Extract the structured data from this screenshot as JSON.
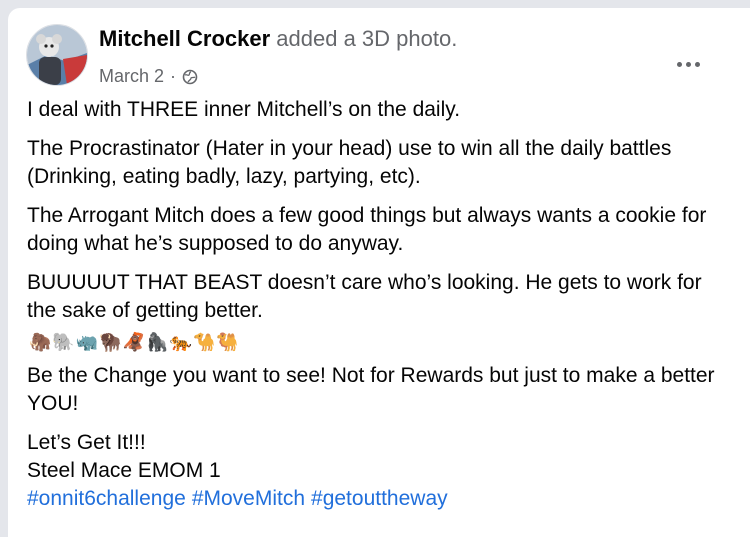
{
  "post": {
    "author": "Mitchell Crocker",
    "action": "added a 3D photo.",
    "date": "March 2",
    "separator": "·",
    "privacy_icon": "globe-icon",
    "menu_icon": "more-options-icon",
    "paragraphs": [
      "I deal with THREE inner Mitchell’s on the daily.",
      "The Procrastinator (Hater in your head) use to win all the daily battles (Drinking, eating badly, lazy, partying, etc).",
      "The Arrogant Mitch does a few good things but always wants a cookie for doing what he’s supposed to do anyway.",
      "BUUUUUT THAT BEAST doesn’t care who’s looking. He gets to work for the sake of getting better."
    ],
    "emojis": [
      "🦣",
      "🐘",
      "🦏",
      "🦬",
      "🦧",
      "🦍",
      "🐅",
      "🐪",
      "🐫"
    ],
    "paragraph_after_emojis": "Be the Change you want to see! Not for Rewards but just to make a better YOU!",
    "closing_lines": [
      "Let’s Get It!!!",
      "Steel Mace EMOM 1"
    ],
    "hashtags": [
      "#onnit6challenge",
      "#MoveMitch",
      "#getouttheway"
    ]
  }
}
